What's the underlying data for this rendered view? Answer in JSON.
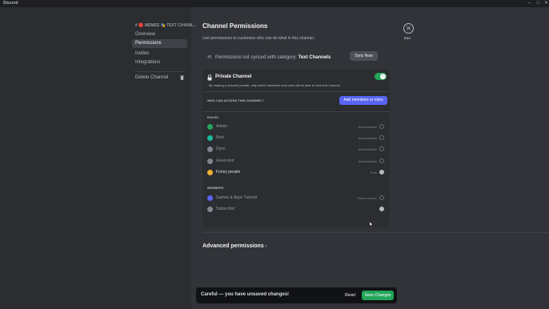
{
  "window": {
    "app_name": "Discord",
    "controls": [
      "–",
      "□",
      "✕"
    ]
  },
  "sidebar": {
    "breadcrumb": "# 🔴 MEMES 🎭 TEXT CHANN...",
    "items": [
      {
        "label": "Overview"
      },
      {
        "label": "Permissions"
      },
      {
        "label": "Invites"
      },
      {
        "label": "Integrations"
      }
    ],
    "delete_label": "Delete Channel"
  },
  "header": {
    "title": "Channel Permissions",
    "subtitle": "Use permissions to customize who can do what in this channel.",
    "esc_label": "ESC"
  },
  "sync": {
    "prefix": "Permissions not synced with category:",
    "category": "Text Channels",
    "button": "Sync Now"
  },
  "private": {
    "title": "Private Channel",
    "description": "By making a channel private, only select members and roles will be able to view this channel.",
    "enabled": true
  },
  "access": {
    "question": "WHO CAN ACCESS THIS CHANNEL?",
    "add_button": "Add members or roles"
  },
  "roles": {
    "heading": "ROLES",
    "items": [
      {
        "name": "Admin",
        "tag": "Administrator",
        "color": "#23a55a"
      },
      {
        "name": "Mod",
        "tag": "Administrator",
        "color": "#1abc9c"
      },
      {
        "name": "Dyno",
        "tag": "Administrator",
        "color": "#80848e"
      },
      {
        "name": "Green-bot",
        "tag": "Administrator",
        "color": "#80848e"
      },
      {
        "name": "Funny people",
        "tag": "Role",
        "color": "#f0b232"
      }
    ]
  },
  "members": {
    "heading": "MEMBERS",
    "items": [
      {
        "name": "Games & Apps Tutorial",
        "tag": "Server Owner",
        "color": "#5865f2"
      },
      {
        "name": "Subscribe!",
        "tag": "",
        "color": "#80848e"
      }
    ]
  },
  "advanced": {
    "label": "Advanced permissions"
  },
  "notice": {
    "message": "Careful — you have unsaved changes!",
    "reset": "Reset",
    "save": "Save Changes"
  },
  "colors": {
    "accent": "#5865f2",
    "success": "#23a55a"
  }
}
